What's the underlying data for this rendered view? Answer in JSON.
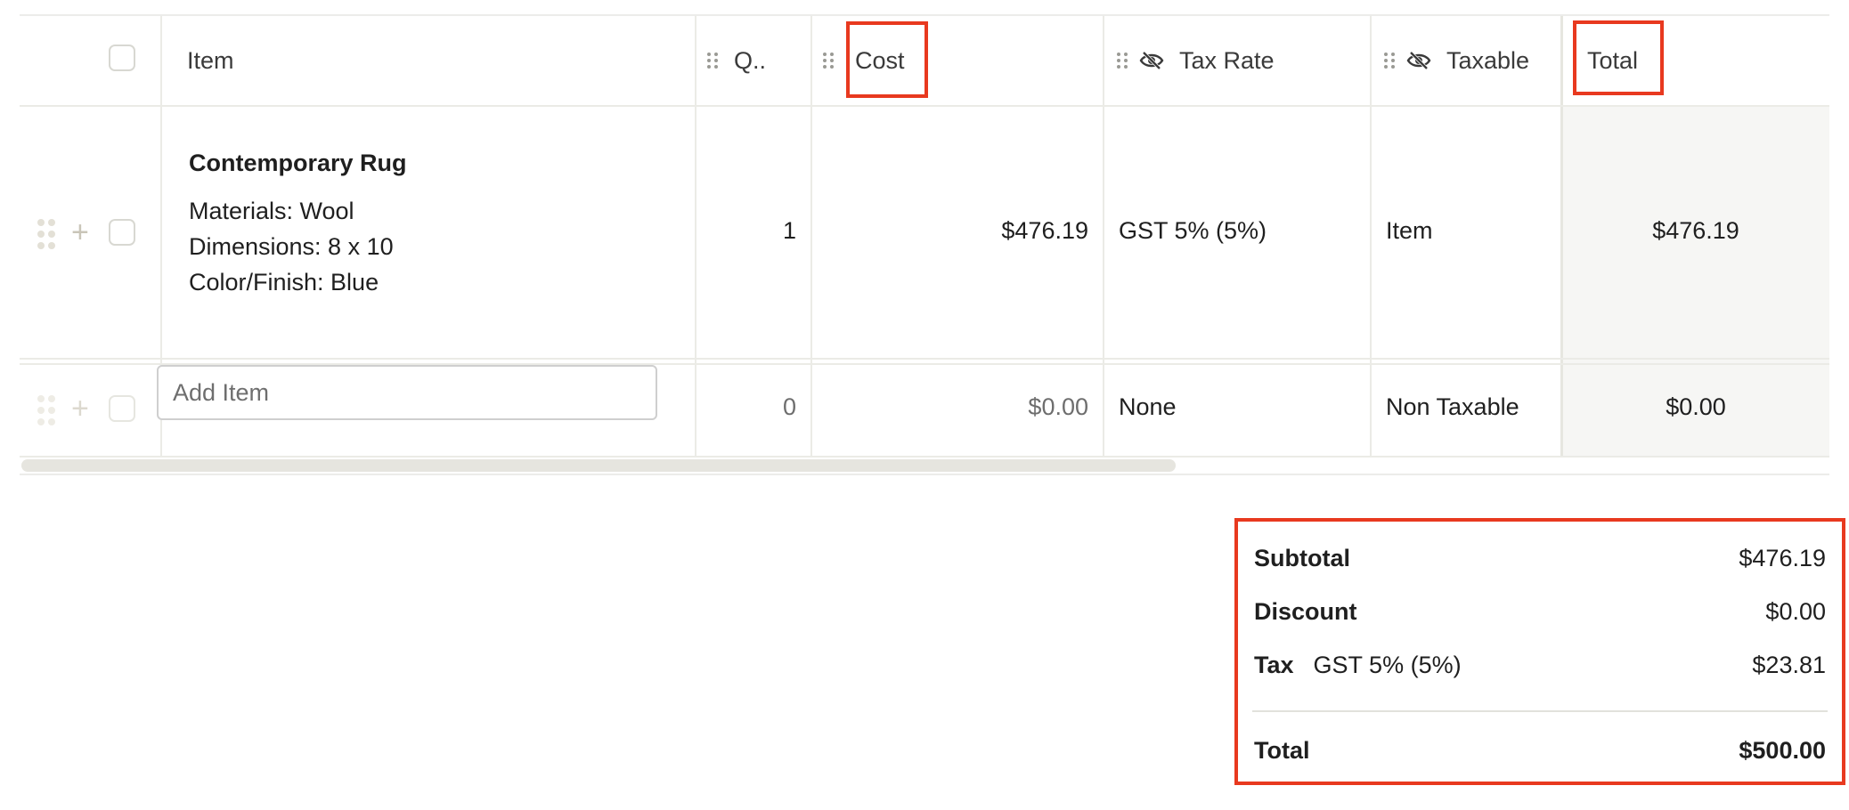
{
  "table": {
    "columns": {
      "item": "Item",
      "qty": "Q..",
      "cost": "Cost",
      "tax_rate": "Tax Rate",
      "taxable": "Taxable",
      "total": "Total"
    },
    "rows": [
      {
        "title": "Contemporary Rug",
        "details": [
          "Materials: Wool",
          "Dimensions: 8 x 10",
          "Color/Finish: Blue"
        ],
        "qty": "1",
        "cost": "$476.19",
        "tax_rate": "GST 5% (5%)",
        "taxable": "Item",
        "total": "$476.19"
      }
    ],
    "add_row": {
      "placeholder": "Add Item",
      "qty": "0",
      "cost": "$0.00",
      "tax_rate": "None",
      "taxable": "Non Taxable",
      "total": "$0.00"
    }
  },
  "summary": {
    "subtotal_label": "Subtotal",
    "subtotal_value": "$476.19",
    "discount_label": "Discount",
    "discount_value": "$0.00",
    "tax_label": "Tax",
    "tax_rate": "GST 5% (5%)",
    "tax_value": "$23.81",
    "total_label": "Total",
    "total_value": "$500.00"
  },
  "colors": {
    "highlight": "#e8391f",
    "grid": "#ebebe6",
    "total_column_bg": "#f6f6f4"
  },
  "icons": {
    "drag_handle": "grip-icon",
    "hidden_column": "eye-slash-icon",
    "add_row": "plus-icon"
  }
}
